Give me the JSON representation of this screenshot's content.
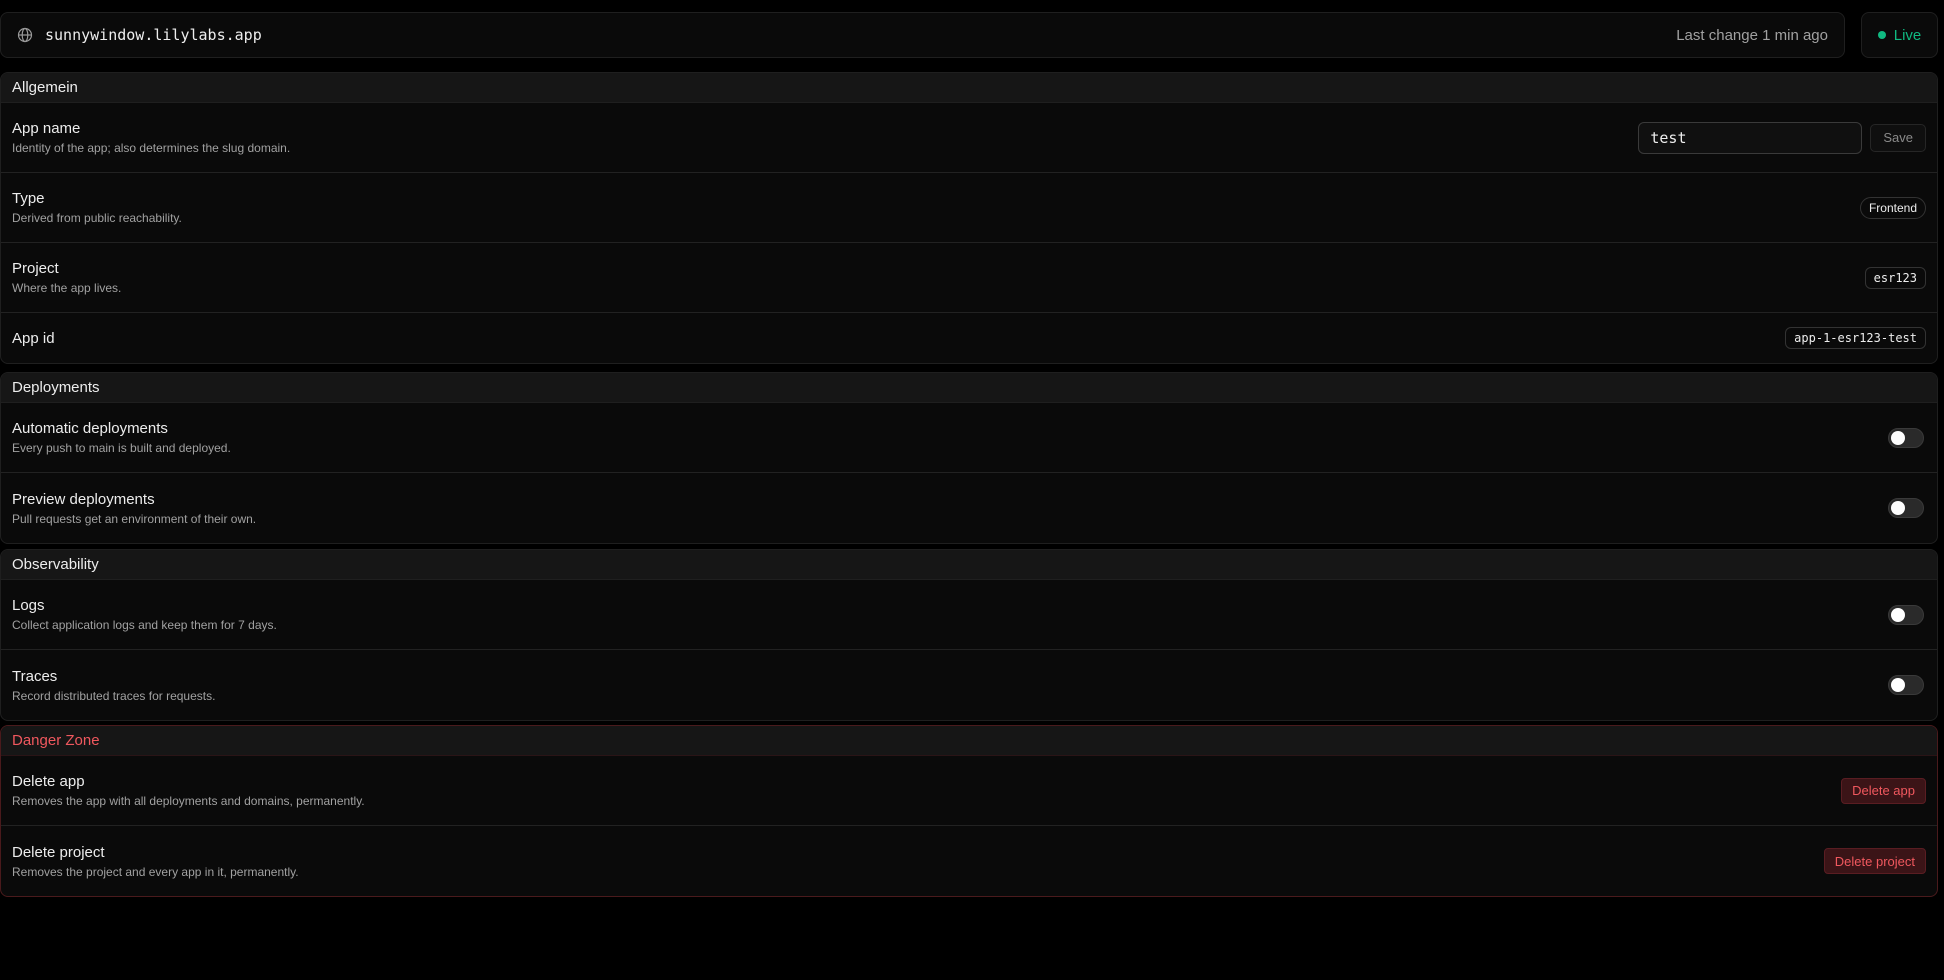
{
  "header": {
    "url": "sunnywindow.lilylabs.app",
    "last_change": "Last change 1 min ago",
    "status": "Live",
    "status_color": "#10b981",
    "icon": "globe-icon"
  },
  "general": {
    "title": "Allgemein",
    "app_name": {
      "label": "App name",
      "desc": "Identity of the app; also determines the slug domain.",
      "value": "test",
      "save_label": "Save"
    },
    "type": {
      "label": "Type",
      "desc": "Derived from public reachability.",
      "value": "Frontend"
    },
    "project": {
      "label": "Project",
      "desc": "Where the app lives.",
      "value": "esr123"
    },
    "app_id": {
      "label": "App id",
      "value": "app-1-esr123-test"
    }
  },
  "deployments": {
    "title": "Deployments",
    "automatic": {
      "label": "Automatic deployments",
      "desc": "Every push to main is built and deployed.",
      "enabled": false
    },
    "preview": {
      "label": "Preview deployments",
      "desc": "Pull requests get an environment of their own.",
      "enabled": false
    }
  },
  "observability": {
    "title": "Observability",
    "logs": {
      "label": "Logs",
      "desc": "Collect application logs and keep them for 7 days.",
      "enabled": false
    },
    "traces": {
      "label": "Traces",
      "desc": "Record distributed traces for requests.",
      "enabled": false
    }
  },
  "danger": {
    "title": "Danger Zone",
    "title_color": "#f0585e",
    "delete_app": {
      "label": "Delete app",
      "desc": "Removes the app with all deployments and domains, permanently.",
      "button": "Delete app"
    },
    "delete_project": {
      "label": "Delete project",
      "desc": "Removes the project and every app in it, permanently.",
      "button": "Delete project"
    }
  }
}
